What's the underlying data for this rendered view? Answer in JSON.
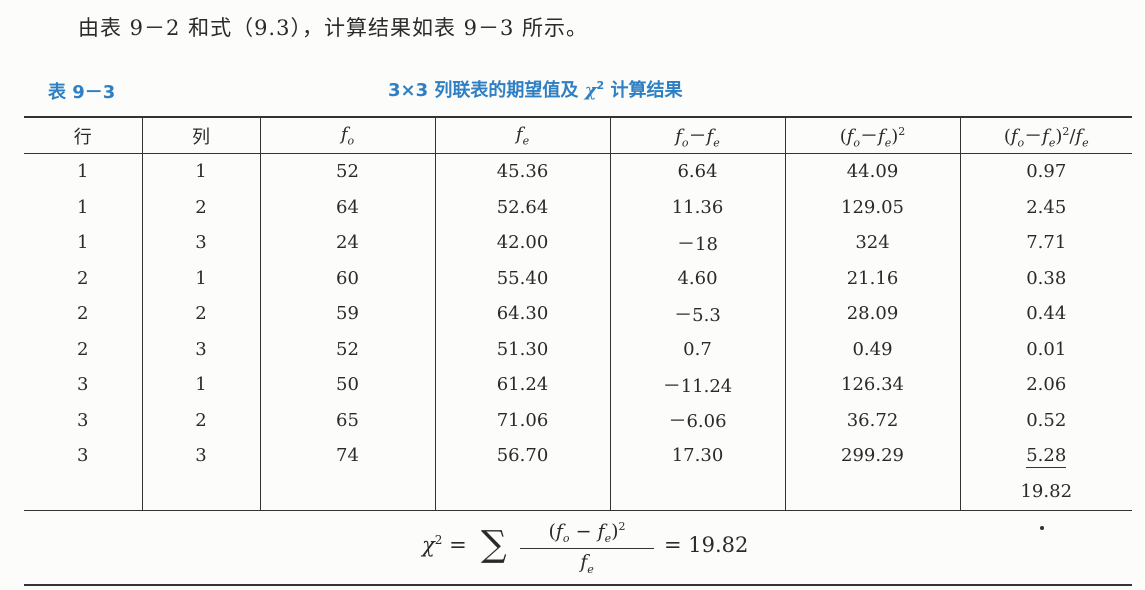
{
  "intro": "由表 9－2 和式（9.3），计算结果如表 9－3 所示。",
  "caption": {
    "number": "表 9－3",
    "title_prefix": "3×3 列联表的期望值及",
    "chi": "χ",
    "chi_power": "2",
    "title_suffix": "计算结果"
  },
  "table": {
    "headers": {
      "row": "行",
      "col": "列",
      "f": "f",
      "o": "o",
      "e": "e",
      "minus": "－",
      "lparen": "(",
      "rparen": ")",
      "slash": "/",
      "power": "2"
    },
    "rows": [
      [
        "1",
        "1",
        "52",
        "45.36",
        "6.64",
        "44.09",
        "0.97"
      ],
      [
        "1",
        "2",
        "64",
        "52.64",
        "11.36",
        "129.05",
        "2.45"
      ],
      [
        "1",
        "3",
        "24",
        "42.00",
        "－18",
        "324",
        "7.71"
      ],
      [
        "2",
        "1",
        "60",
        "55.40",
        "4.60",
        "21.16",
        "0.38"
      ],
      [
        "2",
        "2",
        "59",
        "64.30",
        "－5.3",
        "28.09",
        "0.44"
      ],
      [
        "2",
        "3",
        "52",
        "51.30",
        "0.7",
        "0.49",
        "0.01"
      ],
      [
        "3",
        "1",
        "50",
        "61.24",
        "－11.24",
        "126.34",
        "2.06"
      ],
      [
        "3",
        "2",
        "65",
        "71.06",
        "－6.06",
        "36.72",
        "0.52"
      ],
      [
        "3",
        "3",
        "74",
        "56.70",
        "17.30",
        "299.29",
        "5.28"
      ]
    ],
    "total": "19.82"
  },
  "formula": {
    "chi": "χ",
    "power": "2",
    "equals": "=",
    "sum": "∑",
    "f": "f",
    "o": "o",
    "e": "e",
    "minus": "−",
    "result": "= 19.82"
  }
}
